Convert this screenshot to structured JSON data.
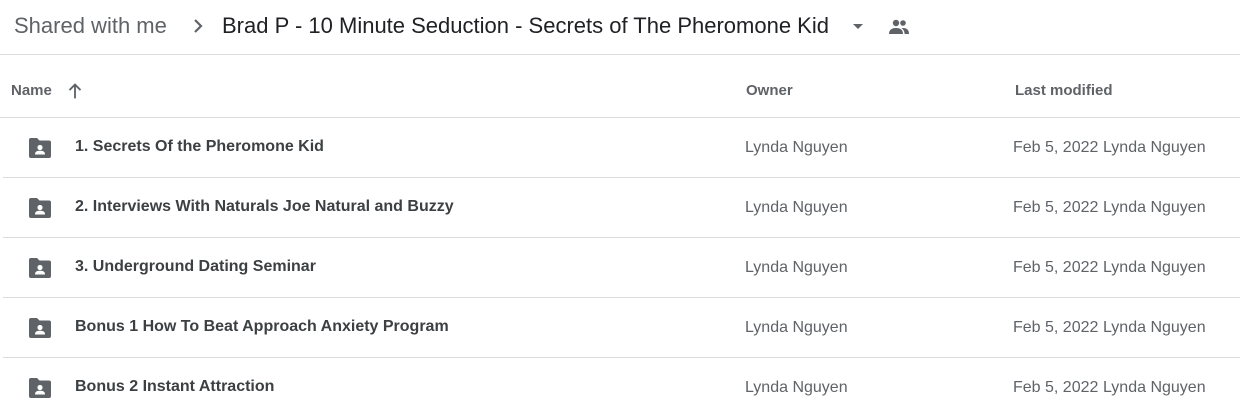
{
  "breadcrumb": {
    "root": "Shared with me",
    "current": "Brad P - 10 Minute Seduction - Secrets of The Pheromone Kid"
  },
  "columns": {
    "name": "Name",
    "owner": "Owner",
    "last_modified": "Last modified"
  },
  "icons": {
    "separator": "chevron-right-icon",
    "dropdown": "arrow-drop-down-icon",
    "shared": "people-icon",
    "sort": "arrow-upward-icon",
    "folder": "shared-folder-icon"
  },
  "colors": {
    "icon": "#5f6368",
    "border": "#dadce0"
  },
  "rows": [
    {
      "name": "1. Secrets Of the Pheromone Kid",
      "owner": "Lynda Nguyen",
      "date": "Feb 5, 2022",
      "modified_by": "Lynda Nguyen"
    },
    {
      "name": "2. Interviews With Naturals Joe Natural and Buzzy",
      "owner": "Lynda Nguyen",
      "date": "Feb 5, 2022",
      "modified_by": "Lynda Nguyen"
    },
    {
      "name": "3. Underground Dating Seminar",
      "owner": "Lynda Nguyen",
      "date": "Feb 5, 2022",
      "modified_by": "Lynda Nguyen"
    },
    {
      "name": "Bonus 1 How To Beat Approach Anxiety Program",
      "owner": "Lynda Nguyen",
      "date": "Feb 5, 2022",
      "modified_by": "Lynda Nguyen"
    },
    {
      "name": "Bonus 2 Instant Attraction",
      "owner": "Lynda Nguyen",
      "date": "Feb 5, 2022",
      "modified_by": "Lynda Nguyen"
    }
  ]
}
